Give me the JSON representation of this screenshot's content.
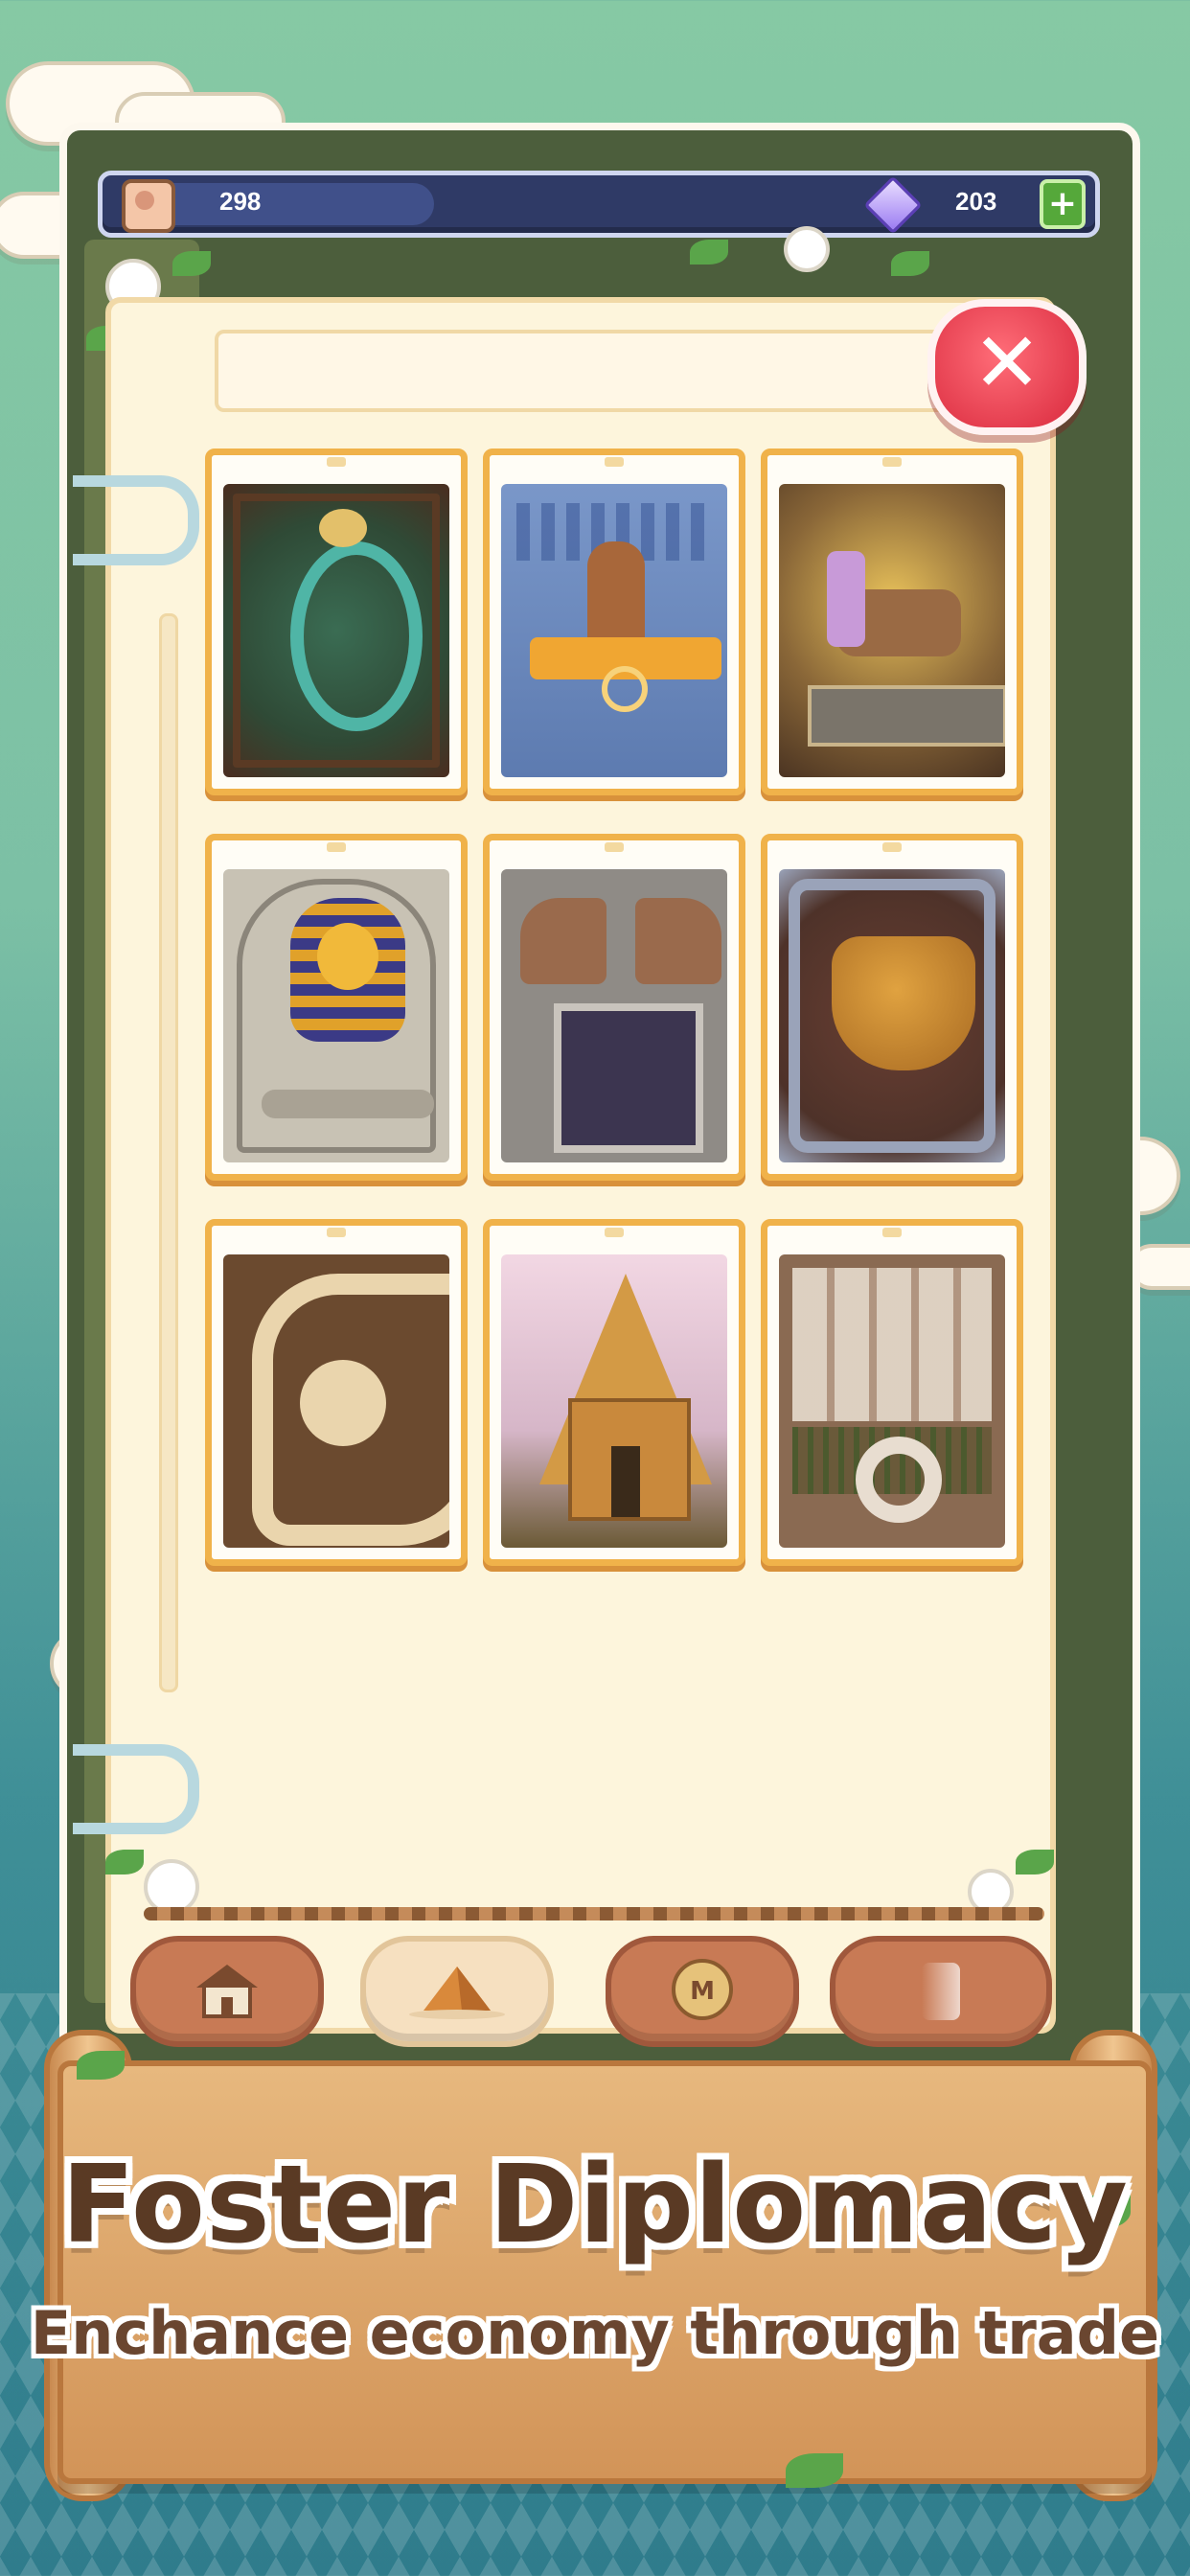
{
  "resources": {
    "population_value": "298",
    "gems_value": "203",
    "add_label": "+"
  },
  "close_label": "✕",
  "collection": {
    "title": "",
    "items": [
      {
        "name": "dragon-relief-card"
      },
      {
        "name": "cuneiform-tablet-card"
      },
      {
        "name": "bull-shrine-card"
      },
      {
        "name": "pharaoh-mask-card"
      },
      {
        "name": "lion-gate-card"
      },
      {
        "name": "clay-pot-card"
      },
      {
        "name": "fossil-relief-card"
      },
      {
        "name": "pyramid-temple-card"
      },
      {
        "name": "city-map-card"
      }
    ]
  },
  "tabs": [
    {
      "icon": "house-icon"
    },
    {
      "icon": "pyramid-icon"
    },
    {
      "icon": "coin-icon"
    },
    {
      "icon": "more-icon"
    }
  ],
  "banner": {
    "headline": "Foster Diplomacy",
    "subheadline": "Enchance economy through trade"
  },
  "colors": {
    "accent_card_border": "#f0b24a",
    "close_button": "#d9293d",
    "topbar": "#2f3a66",
    "banner": "#d29458"
  }
}
